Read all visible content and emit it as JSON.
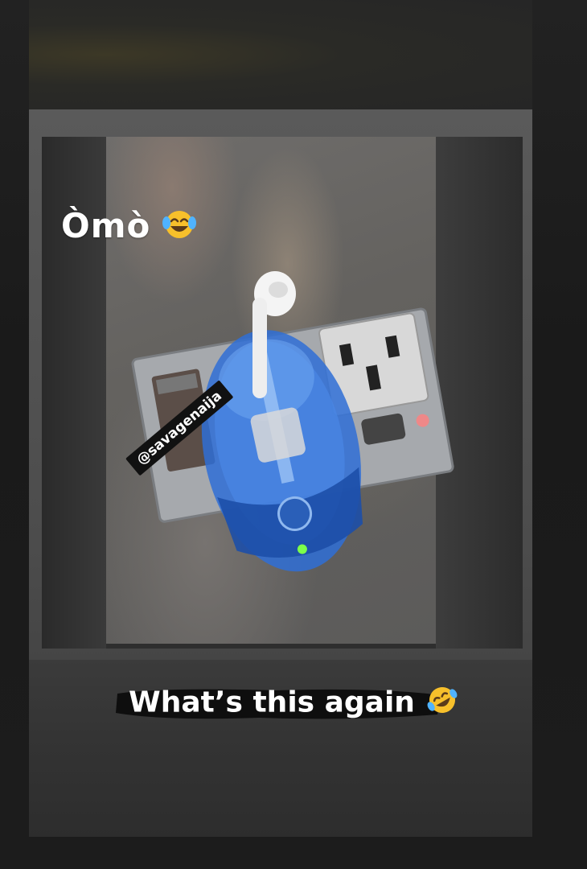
{
  "captions": {
    "top_text": "Òmò",
    "top_emoji": "face-with-tears-of-joy",
    "bottom_text": "What’s this again",
    "bottom_emoji": "rolling-on-the-floor-laughing"
  },
  "watermark": {
    "handle": "@savagenaija"
  },
  "colors": {
    "caption_text": "#ffffff",
    "watermark_bg": "#111111",
    "mouse_blue": "#2f6fd6",
    "emoji_yellow": "#f7c02b"
  }
}
